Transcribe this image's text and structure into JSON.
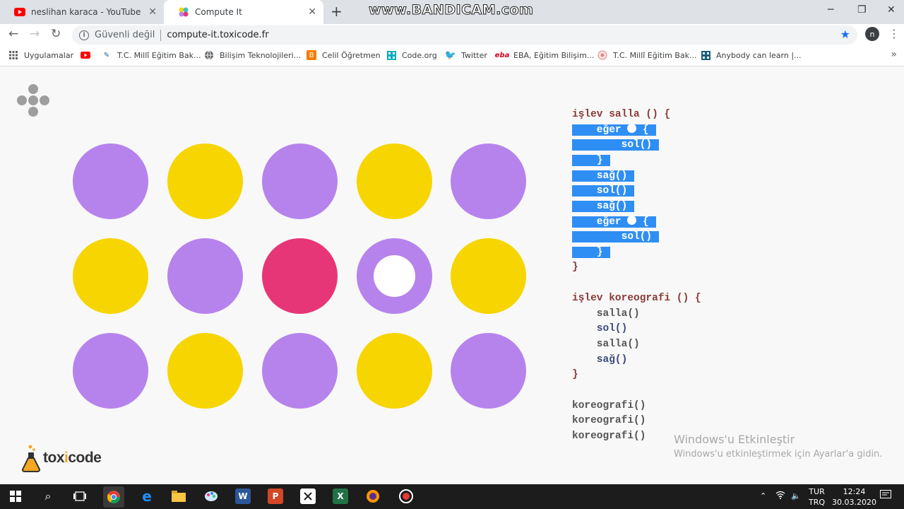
{
  "browser": {
    "tabs": [
      {
        "label": "neslihan karaca - YouTube"
      },
      {
        "label": "Compute It"
      }
    ],
    "watermark": "www.BANDICAM.com",
    "security_label": "Güvenli değil",
    "url": "compute-it.toxicode.fr",
    "profile_initial": "n",
    "bookmarks": [
      {
        "label": "Uygulamalar"
      },
      {
        "label": ""
      },
      {
        "label": "T.C. Millî Eğitim Bak..."
      },
      {
        "label": "Bilişim Teknolojileri..."
      },
      {
        "label": "Celil Öğretmen"
      },
      {
        "label": "Code.org"
      },
      {
        "label": "Twitter"
      },
      {
        "label": "EBA, Eğitim Bilişim..."
      },
      {
        "label": "T.C. Millî Eğitim Bak..."
      },
      {
        "label": "Anybody can learn |..."
      }
    ]
  },
  "grid": {
    "colors": {
      "purple": "#b683ec",
      "yellow": "#f6d500",
      "pink": "#e63677"
    },
    "rows": [
      [
        "purple",
        "yellow",
        "purple",
        "yellow",
        "purple"
      ],
      [
        "yellow",
        "purple",
        "pink",
        "purple-ring",
        "yellow"
      ],
      [
        "purple",
        "yellow",
        "purple",
        "yellow",
        "purple"
      ]
    ]
  },
  "logo": {
    "prefix": "tox",
    "accent": "i",
    "suffix": "code"
  },
  "code": {
    "l1_kw": "işlev",
    "l1_name": " salla () {",
    "l2": "    eğer ",
    "l2_end": " {",
    "l3": "        sol()",
    "l4": "    }",
    "l5": "    sağ()",
    "l6": "    sol()",
    "l7": "    sağ()",
    "l8": "    eğer ",
    "l8_end": " {",
    "l9": "        sol()",
    "l10": "    }",
    "l11": "}",
    "l12_kw": "işlev",
    "l12_name": " koreografi () {",
    "l13": "    salla()",
    "l14": "    sol()",
    "l15": "    salla()",
    "l16": "    sağ()",
    "l17": "}",
    "l18": "koreografi()",
    "l19": "koreografi()",
    "l20": "koreografi()"
  },
  "activation": {
    "title": "Windows'u Etkinleştir",
    "subtitle": "Windows'u etkinleştirmek için Ayarlar'a gidin."
  },
  "taskbar": {
    "lang_top": "TUR",
    "lang_bottom": "TRQ",
    "time": "12:24",
    "date": "30.03.2020"
  }
}
